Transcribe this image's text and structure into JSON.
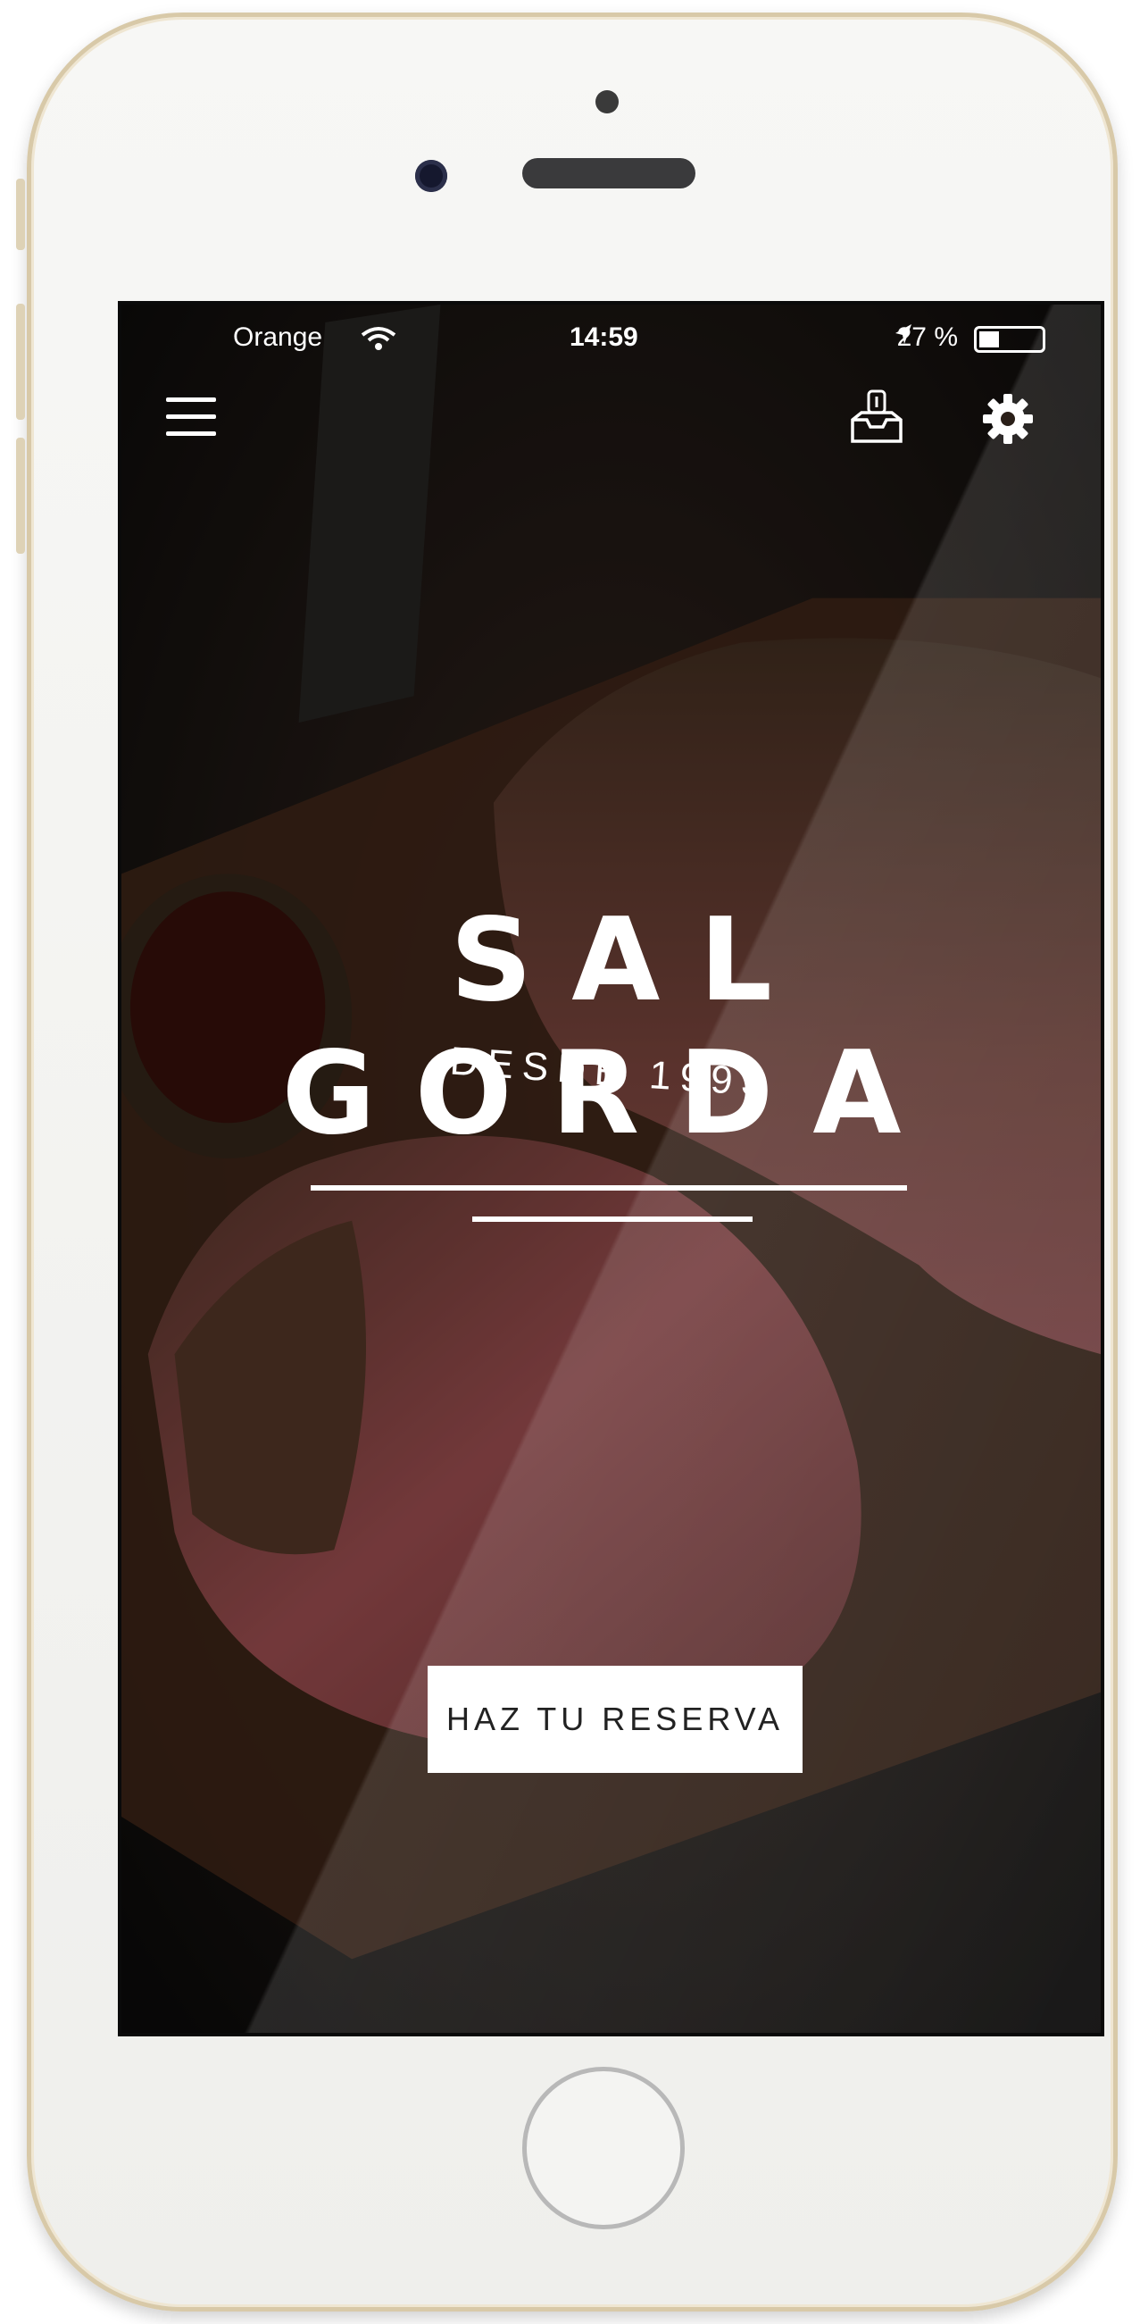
{
  "status_bar": {
    "carrier": "Orange",
    "time": "14:59",
    "battery": "27 %"
  },
  "header": {
    "menu_icon": "hamburger-menu-icon",
    "reservations_icon": "tray-inbox-icon",
    "settings_icon": "gear-icon"
  },
  "hero": {
    "title": "SAL GORDA",
    "subtitle": "DESDE 1993",
    "cta_label": "HAZ TU RESERVA"
  },
  "colors": {
    "text": "#ffffff",
    "button_bg": "#ffffff",
    "button_text": "#222222",
    "phone_frame": "#d8c9a8"
  }
}
